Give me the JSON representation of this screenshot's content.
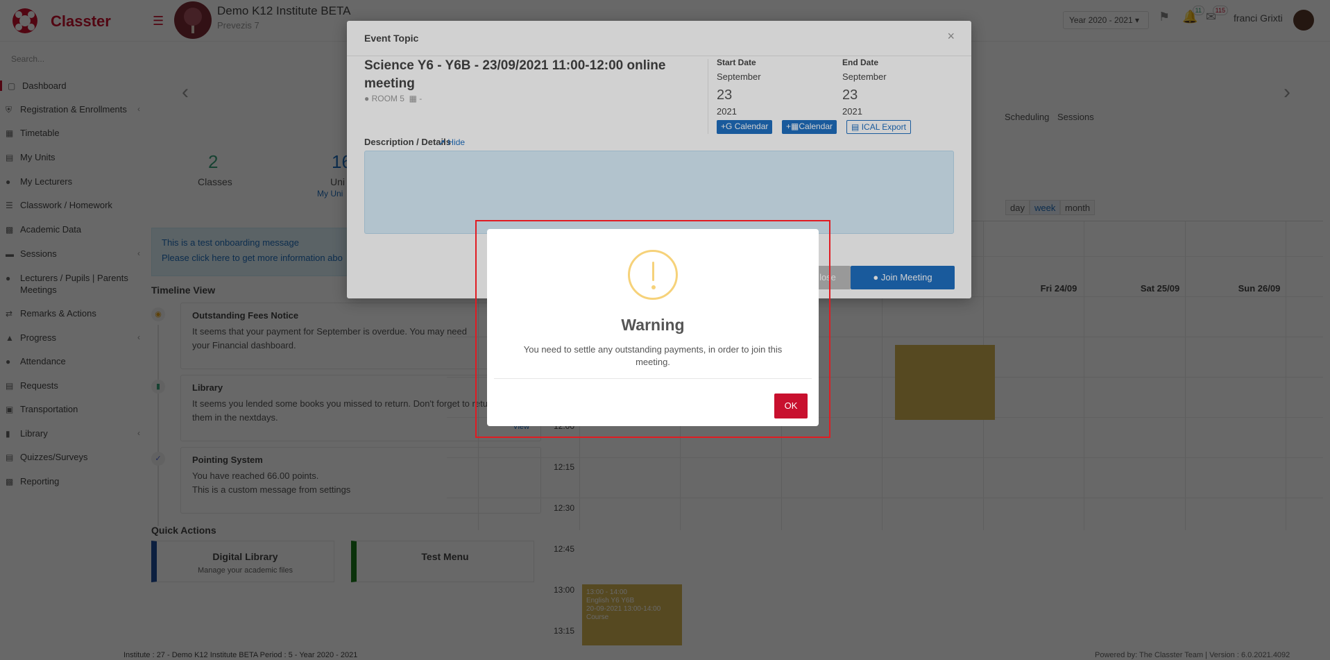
{
  "app": {
    "name": "Classter"
  },
  "header": {
    "institute_name": "Demo K12 Institute BETA",
    "institute_sub": "Prevezis 7",
    "year_select": "Year 2020 - 2021",
    "notif_badge": "11",
    "mail_badge": "115",
    "user_name": "franci Grixti"
  },
  "sidebar": {
    "search_placeholder": "Search...",
    "items": [
      {
        "label": "Dashboard",
        "icon": "laptop-icon"
      },
      {
        "label": "Registration & Enrollments",
        "icon": "bank-icon"
      },
      {
        "label": "Timetable",
        "icon": "calendar-icon"
      },
      {
        "label": "My Units",
        "icon": "book-icon"
      },
      {
        "label": "My Lecturers",
        "icon": "users-icon"
      },
      {
        "label": "Classwork / Homework",
        "icon": "list-icon"
      },
      {
        "label": "Academic Data",
        "icon": "chart-icon"
      },
      {
        "label": "Sessions",
        "icon": "gamepad-icon"
      },
      {
        "label": "Lecturers / Pupils | Parents Meetings",
        "icon": "users-icon"
      },
      {
        "label": "Remarks & Actions",
        "icon": "shuffle-icon"
      },
      {
        "label": "Progress",
        "icon": "graduation-cap-icon"
      },
      {
        "label": "Attendance",
        "icon": "user-check-icon"
      },
      {
        "label": "Requests",
        "icon": "file-icon"
      },
      {
        "label": "Transportation",
        "icon": "bus-icon"
      },
      {
        "label": "Library",
        "icon": "library-icon"
      },
      {
        "label": "Quizzes/Surveys",
        "icon": "clipboard-icon"
      },
      {
        "label": "Reporting",
        "icon": "print-icon"
      }
    ]
  },
  "stats": [
    {
      "value": "2",
      "label": "Classes"
    },
    {
      "value": "16",
      "label": "Uni",
      "link": "My Uni"
    }
  ],
  "onboarding": {
    "line1": "This is a test onboarding message",
    "line2": "Please click here to get more information abo"
  },
  "timeline": {
    "title": "Timeline View",
    "cards": [
      {
        "title": "Outstanding Fees Notice",
        "text": "It seems that your payment for September is overdue. You may need",
        "text2": "your Financial dashboard."
      },
      {
        "title": "Library",
        "text": "It seems you lended some books you missed to return. Don't forget to return",
        "text2": "them in the nextdays.",
        "link": "View"
      },
      {
        "title": "Pointing System",
        "text": "You have reached 66.00 points.",
        "text2": "This is a custom message from settings"
      }
    ]
  },
  "quick_actions": {
    "title": "Quick Actions",
    "cards": [
      {
        "title": "Digital Library",
        "subtitle": "Manage your academic files",
        "color": "#1f4e9c"
      },
      {
        "title": "Test Menu",
        "subtitle": "",
        "color": "#1a7a1a"
      }
    ]
  },
  "footer": {
    "left": "Institute : 27 - Demo K12 Institute BETA Period : 5 - Year 2020 - 2021",
    "right": "Powered by: The Classter Team  | Version : 6.0.2021.4092"
  },
  "calendar": {
    "links": [
      "Scheduling",
      "Sessions"
    ],
    "views": [
      "day",
      "week",
      "month"
    ],
    "active_view": "week",
    "days": [
      "Fri 24/09",
      "Sat 25/09",
      "Sun 26/09"
    ],
    "times": [
      "12:00",
      "12:15",
      "12:30",
      "12:45",
      "13:00",
      "13:15"
    ],
    "event": {
      "time": "13:00 - 14:00",
      "name": "English Y6 Y6B",
      "date": "20-09-2021 13:00-14:00",
      "type": "Course"
    }
  },
  "event_modal": {
    "title": "Event Topic",
    "event_title": "Science Y6 - Y6B - 23/09/2021 11:00-12:00 online meeting",
    "room": "ROOM 5",
    "room_extra": "-",
    "start": {
      "label": "Start Date",
      "month": "September",
      "day": "23",
      "year": "2021"
    },
    "end": {
      "label": "End Date",
      "month": "September",
      "day": "23",
      "year": "2021"
    },
    "google_calendar": "Calendar",
    "windows_calendar": "Calendar",
    "ical_export": "ICAL Export",
    "description_label": "Description / Details",
    "hide_label": "Hide",
    "close_label": "lose",
    "join_label": "Join Meeting"
  },
  "warning": {
    "title": "Warning",
    "message": "You need to settle any outstanding payments, in order to join this meeting.",
    "ok": "OK"
  },
  "colors": {
    "brand": "#c8102e",
    "primary": "#1f6ebf",
    "warning_icon": "#f6d27a",
    "event": "#d5b352"
  }
}
